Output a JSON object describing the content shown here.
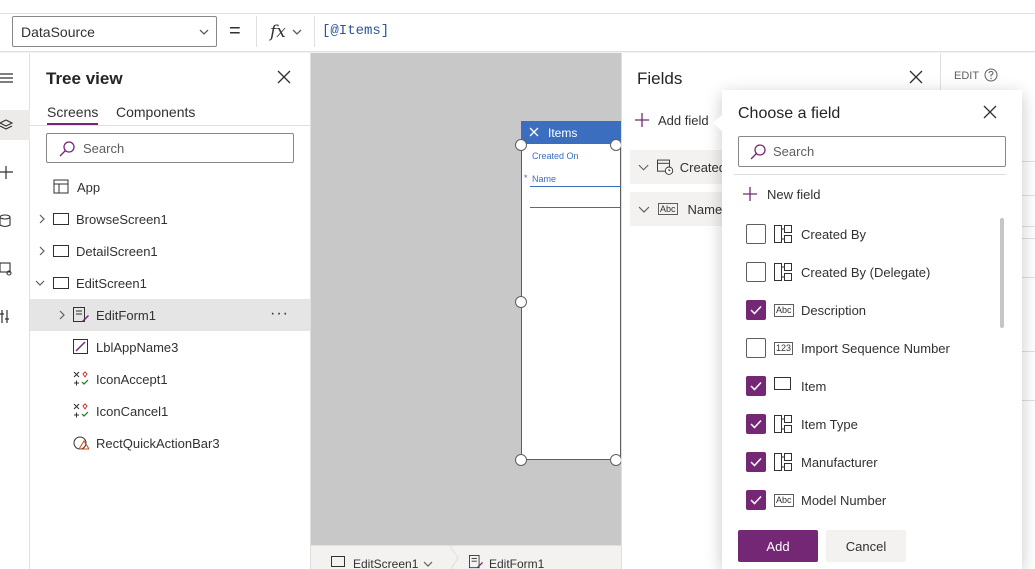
{
  "formula_bar": {
    "property": "DataSource",
    "equals": "=",
    "fx_label": "fx",
    "formula": "[@Items]"
  },
  "tree": {
    "title": "Tree view",
    "tabs": [
      "Screens",
      "Components"
    ],
    "search_placeholder": "Search",
    "nodes": [
      {
        "label": "App",
        "icon": "app-icon"
      },
      {
        "label": "BrowseScreen1",
        "icon": "screen-icon"
      },
      {
        "label": "DetailScreen1",
        "icon": "screen-icon"
      },
      {
        "label": "EditScreen1",
        "icon": "screen-icon"
      },
      {
        "label": "EditForm1",
        "icon": "form-icon"
      },
      {
        "label": "LblAppName3",
        "icon": "label-icon"
      },
      {
        "label": "IconAccept1",
        "icon": "icon-control-icon"
      },
      {
        "label": "IconCancel1",
        "icon": "icon-control-icon"
      },
      {
        "label": "RectQuickActionBar3",
        "icon": "shape-icon"
      }
    ],
    "more": "···"
  },
  "canvas": {
    "header_title": "Items",
    "field1": "Created On",
    "field2_required": "*",
    "field2": "Name"
  },
  "bottom_bar": {
    "screen": "EditScreen1",
    "control": "EditForm1"
  },
  "fields_pane": {
    "title": "Fields",
    "add_field": "Add field",
    "rows": [
      {
        "label": "Created",
        "icon": "datetime-icon"
      },
      {
        "label": "Name",
        "icon": "text-icon"
      }
    ]
  },
  "props_pane": {
    "edit": "EDIT"
  },
  "choose_field": {
    "title": "Choose a field",
    "search_placeholder": "Search",
    "new_field": "New field",
    "items": [
      {
        "label": "Created By",
        "checked": false,
        "icon": "lookup-icon"
      },
      {
        "label": "Created By (Delegate)",
        "checked": false,
        "icon": "lookup-icon"
      },
      {
        "label": "Description",
        "checked": true,
        "icon": "text-icon"
      },
      {
        "label": "Import Sequence Number",
        "checked": false,
        "icon": "number-icon"
      },
      {
        "label": "Item",
        "checked": true,
        "icon": "primary-name-icon"
      },
      {
        "label": "Item Type",
        "checked": true,
        "icon": "lookup-icon"
      },
      {
        "label": "Manufacturer",
        "checked": true,
        "icon": "lookup-icon"
      },
      {
        "label": "Model Number",
        "checked": true,
        "icon": "text-icon"
      }
    ],
    "add_button": "Add",
    "cancel_button": "Cancel"
  }
}
